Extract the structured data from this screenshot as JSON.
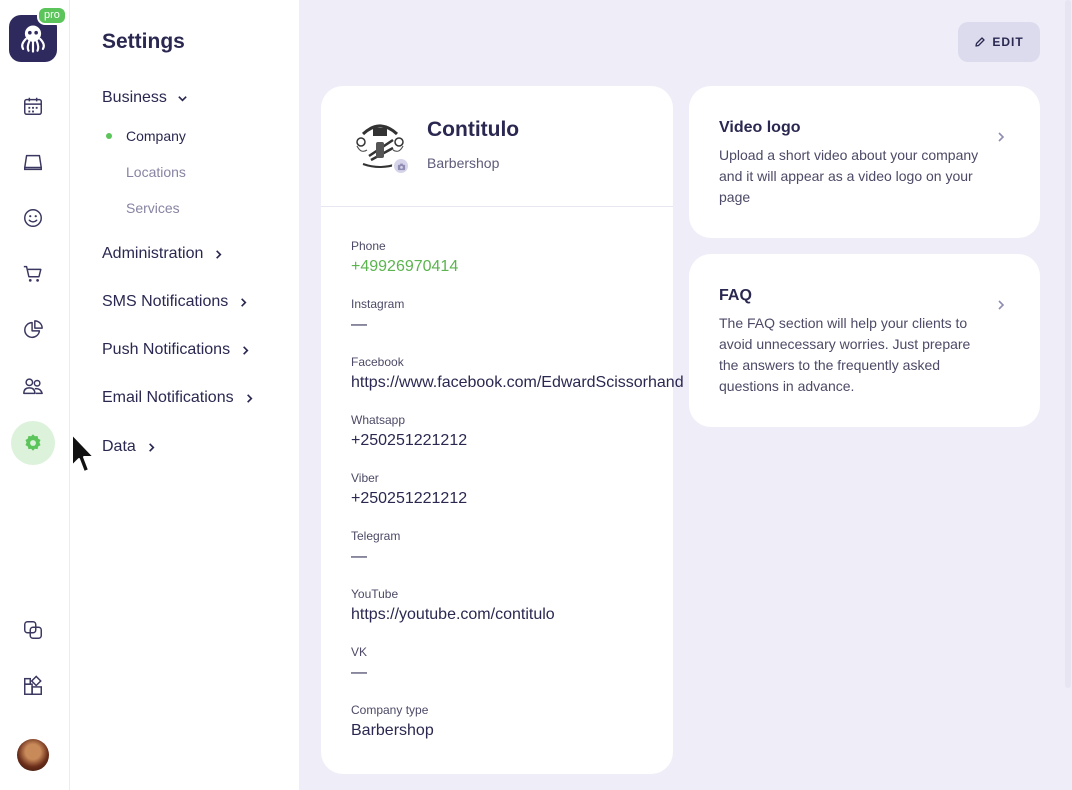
{
  "rail": {
    "badge": "pro",
    "icons": [
      "calendar-icon",
      "inbox-icon",
      "smile-icon",
      "cart-icon",
      "pie-chart-icon",
      "users-icon",
      "settings-icon",
      "copy-icon",
      "widgets-icon"
    ],
    "active": "settings-icon",
    "accent_active_bg": "#dcf2db",
    "accent_active_fg": "#5bc45a"
  },
  "nav": {
    "title": "Settings",
    "business": "Business",
    "business_items": [
      "Company",
      "Locations",
      "Services"
    ],
    "groups": [
      "Administration",
      "SMS Notifications",
      "Push Notifications",
      "Email Notifications",
      "Data"
    ]
  },
  "toolbar": {
    "edit_label": "EDIT"
  },
  "company": {
    "name": "Contitulo",
    "type_label": "Barbershop",
    "fields": [
      {
        "label": "Phone",
        "value": "+49926970414"
      },
      {
        "label": "Instagram",
        "value": "—"
      },
      {
        "label": "Facebook",
        "value": "https://www.facebook.com/EdwardScissorhand"
      },
      {
        "label": "Whatsapp",
        "value": "+250251221212"
      },
      {
        "label": "Viber",
        "value": "+250251221212"
      },
      {
        "label": "Telegram",
        "value": "—"
      },
      {
        "label": "YouTube",
        "value": "https://youtube.com/contitulo"
      },
      {
        "label": "VK",
        "value": "—"
      },
      {
        "label": "Company type",
        "value": "Barbershop"
      }
    ]
  },
  "cards": {
    "video": {
      "title": "Video logo",
      "text": "Upload a short video about your company and it will appear as a video logo on your page"
    },
    "faq": {
      "title": "FAQ",
      "text": "The FAQ section will help your clients to avoid unnecessary worries. Just prepare the answers to the frequently asked questions in advance."
    }
  },
  "colors": {
    "background": "#eeedf8",
    "brand_dark": "#2f2a5e",
    "green": "#5bc45a"
  }
}
